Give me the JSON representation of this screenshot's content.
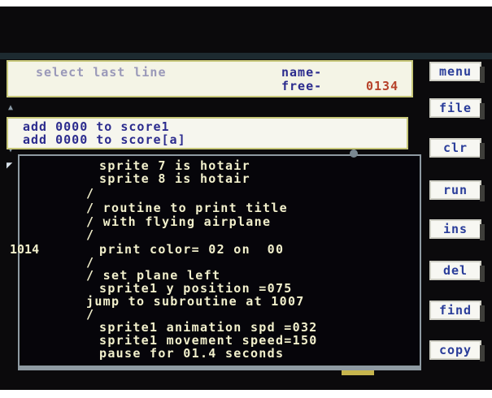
{
  "status_bar": {
    "hint": "select last line",
    "name_label": "name-",
    "free_label": "free-",
    "free_value": "0134"
  },
  "command_area": {
    "lines": [
      "add 0000 to score1",
      "add 0000 to score[a]"
    ]
  },
  "code_area": {
    "line_number": "1014",
    "lines": [
      "sprite 7 is hotair",
      "sprite 8 is hotair",
      "/",
      "/ routine to print title",
      "/ with flying airplane",
      "/",
      "print color= 02 on  00",
      "/",
      "/ set plane left",
      "sprite1 y position =075",
      "jump to subroutine at 1007",
      "/",
      "sprite1 animation spd =032",
      "sprite1 movement speed=150",
      "pause for 01.4 seconds"
    ]
  },
  "menu": {
    "menu": "menu",
    "file": "file",
    "clr": "clr",
    "run": "run",
    "ins": "ins",
    "del": "del",
    "find": "find",
    "copy": "copy"
  },
  "colors": {
    "screen_bg": "#0b0a0c",
    "panel_bg": "#f4f4e6",
    "code_text": "#f2f0cc",
    "button_text": "#2a3d9a",
    "hint_text": "#9a99b9",
    "counter_text": "#b6422a"
  }
}
